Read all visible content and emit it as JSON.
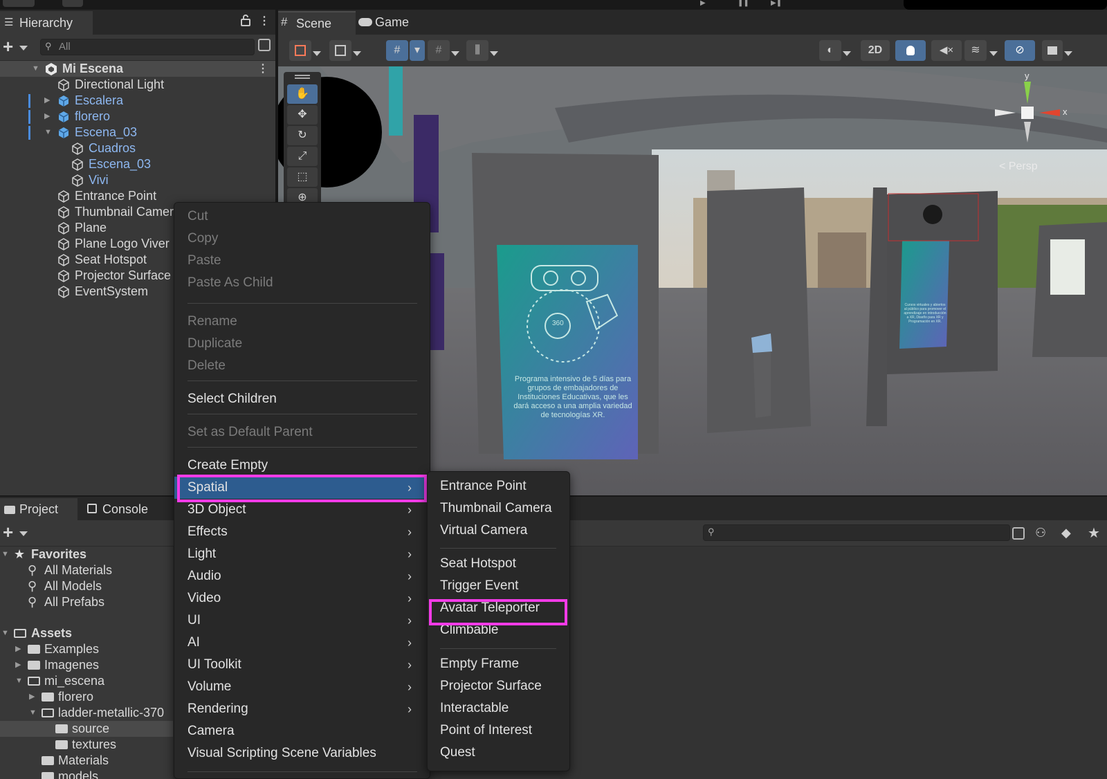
{
  "hierarchy": {
    "tab_label": "Hierarchy",
    "search_placeholder": "All",
    "items": [
      {
        "label": "Mi Escena"
      },
      {
        "label": "Directional Light"
      },
      {
        "label": "Escalera"
      },
      {
        "label": "florero"
      },
      {
        "label": "Escena_03"
      },
      {
        "label": "Cuadros"
      },
      {
        "label": "Escena_03"
      },
      {
        "label": "Vivi"
      },
      {
        "label": "Entrance Point"
      },
      {
        "label": "Thumbnail Camera"
      },
      {
        "label": "Plane"
      },
      {
        "label": "Plane Logo Viver"
      },
      {
        "label": "Seat Hotspot"
      },
      {
        "label": "Projector Surface"
      },
      {
        "label": "EventSystem"
      }
    ]
  },
  "scene": {
    "tabs": [
      {
        "label": "Scene"
      },
      {
        "label": "Game"
      }
    ],
    "toolbar": {
      "mode_2d": "2D"
    },
    "gizmo": {
      "y_axis": "y",
      "x_axis": "x",
      "projection": "< Persp"
    },
    "poster_text": "Programa intensivo de 5 días para grupos de embajadores de Instituciones Educativas, que les dará acceso a una amplia variedad de tecnologías XR.",
    "poster_badge": "360",
    "small_poster_text": "Cursos virtuales y abiertos al público para promover el aprendizaje en introducción a XR, Diseño para XR y Programación en XR."
  },
  "project": {
    "tabs": [
      {
        "label": "Project"
      },
      {
        "label": "Console"
      }
    ],
    "tree": [
      {
        "label": "Favorites"
      },
      {
        "label": "All Materials"
      },
      {
        "label": "All Models"
      },
      {
        "label": "All Prefabs"
      },
      {
        "label": "Assets"
      },
      {
        "label": "Examples"
      },
      {
        "label": "Imagenes"
      },
      {
        "label": "mi_escena"
      },
      {
        "label": "florero"
      },
      {
        "label": "ladder-metallic-370"
      },
      {
        "label": "source"
      },
      {
        "label": "textures"
      },
      {
        "label": "Materials"
      },
      {
        "label": "models"
      }
    ]
  },
  "context_menu": {
    "items": [
      {
        "label": "Cut"
      },
      {
        "label": "Copy"
      },
      {
        "label": "Paste"
      },
      {
        "label": "Paste As Child"
      },
      {
        "label": "Rename"
      },
      {
        "label": "Duplicate"
      },
      {
        "label": "Delete"
      },
      {
        "label": "Select Children"
      },
      {
        "label": "Set as Default Parent"
      },
      {
        "label": "Create Empty"
      },
      {
        "label": "Spatial"
      },
      {
        "label": "3D Object"
      },
      {
        "label": "Effects"
      },
      {
        "label": "Light"
      },
      {
        "label": "Audio"
      },
      {
        "label": "Video"
      },
      {
        "label": "UI"
      },
      {
        "label": "AI"
      },
      {
        "label": "UI Toolkit"
      },
      {
        "label": "Volume"
      },
      {
        "label": "Rendering"
      },
      {
        "label": "Camera"
      },
      {
        "label": "Visual Scripting Scene Variables"
      }
    ]
  },
  "spatial_submenu": {
    "items": [
      {
        "label": "Entrance Point"
      },
      {
        "label": "Thumbnail Camera"
      },
      {
        "label": "Virtual Camera"
      },
      {
        "label": "Seat Hotspot"
      },
      {
        "label": "Trigger Event"
      },
      {
        "label": "Avatar Teleporter"
      },
      {
        "label": "Climbable"
      },
      {
        "label": "Empty Frame"
      },
      {
        "label": "Projector Surface"
      },
      {
        "label": "Interactable"
      },
      {
        "label": "Point of Interest"
      },
      {
        "label": "Quest"
      }
    ]
  },
  "colors": {
    "highlight_box": "#f23be7",
    "menu_highlight": "#2d5c8f",
    "prefab_blue": "#8db7f0",
    "panel": "#383838"
  }
}
